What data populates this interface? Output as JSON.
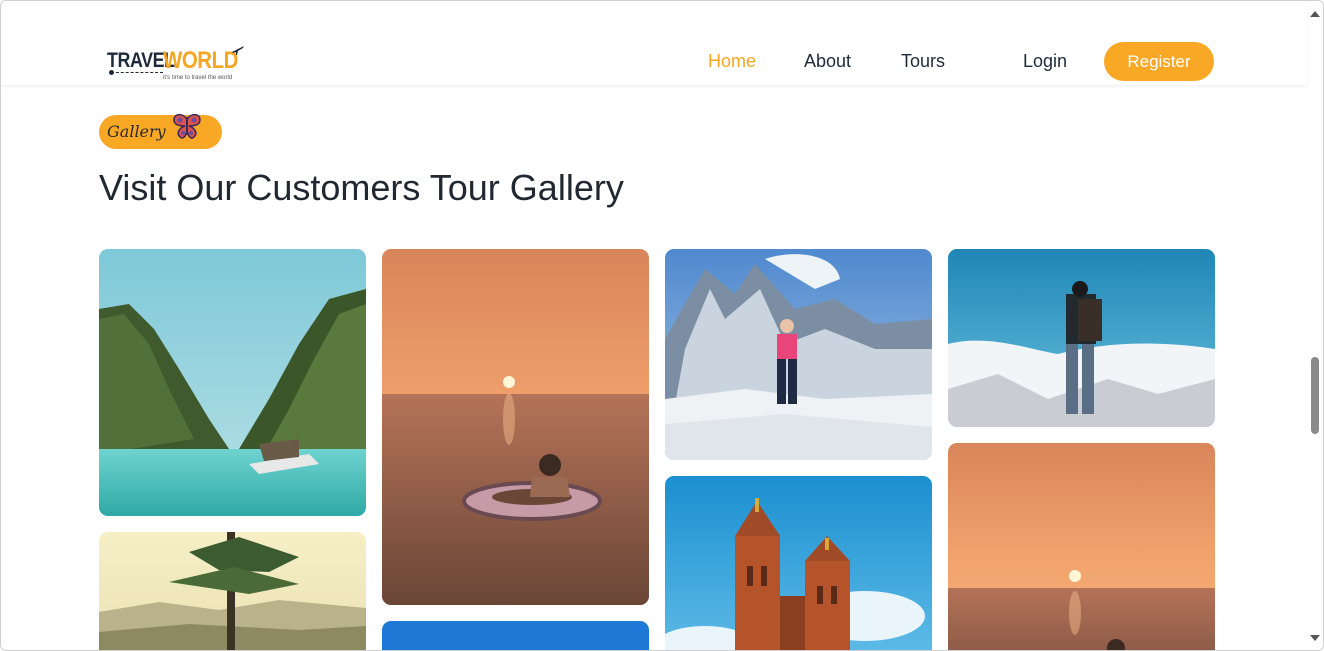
{
  "header": {
    "logo": {
      "word1": "TRAVEL",
      "word2": "WORLD",
      "tagline": "it's time to travel the world"
    },
    "nav": [
      {
        "label": "Home",
        "active": true
      },
      {
        "label": "About",
        "active": false
      },
      {
        "label": "Tours",
        "active": false
      }
    ],
    "login_label": "Login",
    "register_label": "Register"
  },
  "section": {
    "badge_label": "Gallery",
    "title": "Visit Our Customers Tour Gallery"
  },
  "gallery": {
    "photos": [
      {
        "subject": "tropical lagoon with boat"
      },
      {
        "subject": "sunset sea with swimmer on float"
      },
      {
        "subject": "hiker on snowy mountain"
      },
      {
        "subject": "backpacker above clouds"
      },
      {
        "subject": "pine tree over valley"
      },
      {
        "subject": "blue sky"
      },
      {
        "subject": "gothic brick church towers"
      },
      {
        "subject": "sunset sea"
      }
    ]
  },
  "colors": {
    "accent": "#f9a826",
    "text_dark": "#222831"
  },
  "icons": [
    "plane-icon",
    "butterfly-icon",
    "scroll-up-icon",
    "scroll-down-icon"
  ]
}
